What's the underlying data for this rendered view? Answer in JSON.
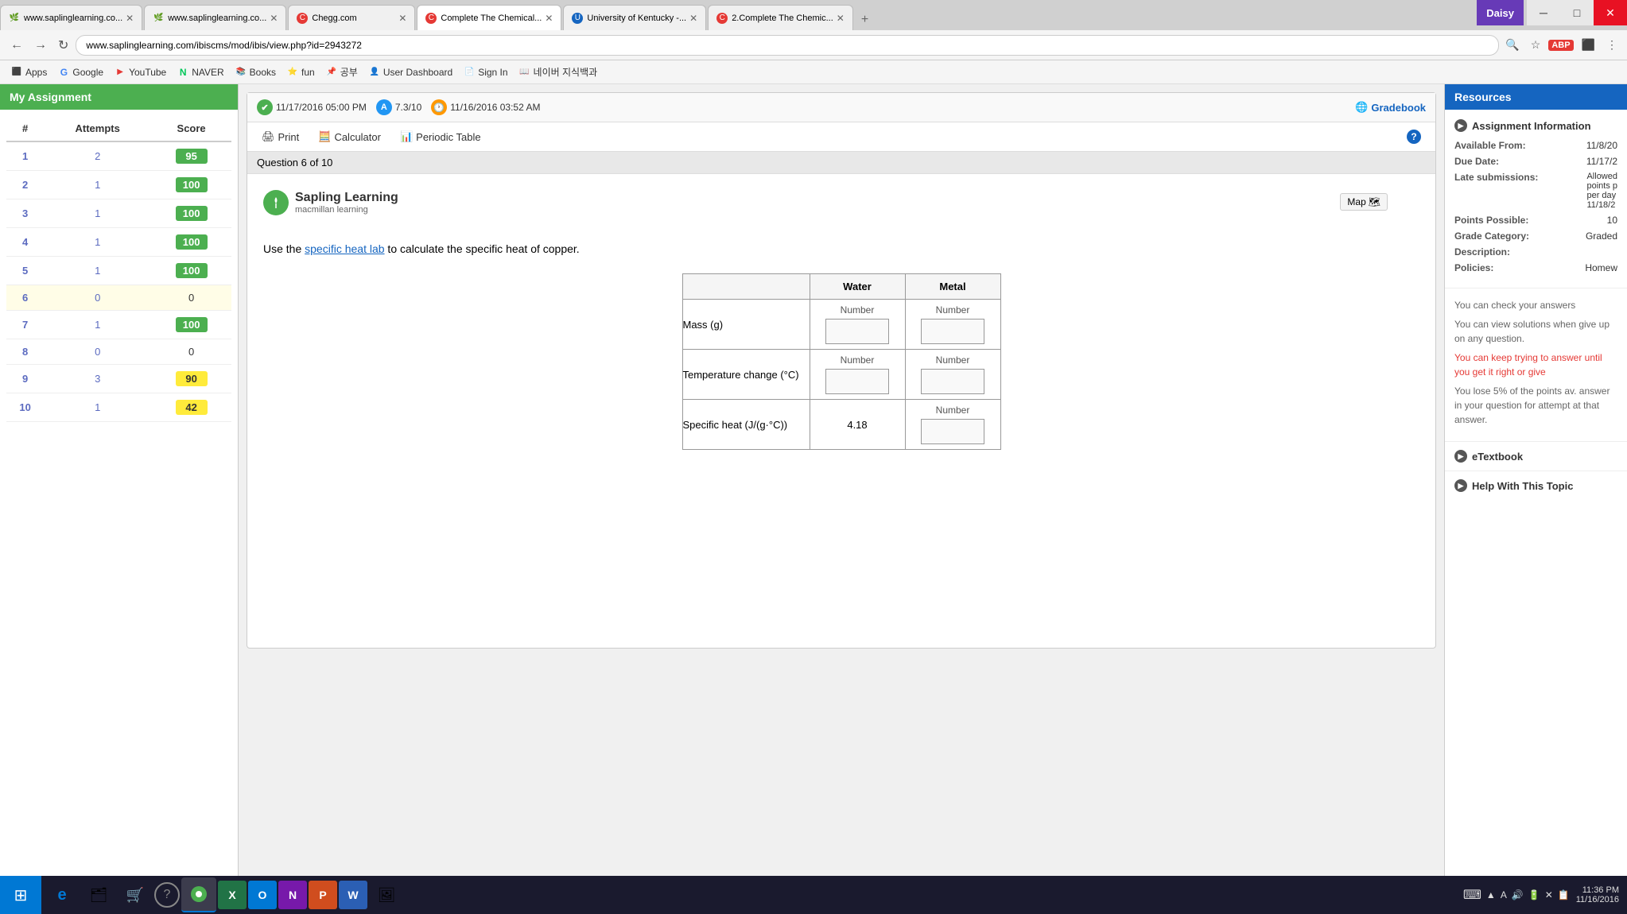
{
  "browser": {
    "tabs": [
      {
        "id": 1,
        "title": "www.saplinglearning.co...",
        "favicon": "🌿",
        "active": false,
        "favicon_color": "#4caf50"
      },
      {
        "id": 2,
        "title": "www.saplinglearning.co...",
        "favicon": "🌿",
        "active": false,
        "favicon_color": "#4caf50"
      },
      {
        "id": 3,
        "title": "Chegg.com",
        "favicon": "C",
        "active": false,
        "favicon_color": "#e53935"
      },
      {
        "id": 4,
        "title": "Complete The Chemical...",
        "favicon": "C",
        "active": true,
        "favicon_color": "#e53935"
      },
      {
        "id": 5,
        "title": "University of Kentucky -...",
        "favicon": "U",
        "active": false,
        "favicon_color": "#1565c0"
      },
      {
        "id": 6,
        "title": "2.Complete The Chemic...",
        "favicon": "C",
        "active": false,
        "favicon_color": "#e53935"
      }
    ],
    "url": "www.saplinglearning.com/ibiscms/mod/ibis/view.php?id=2943272",
    "daisy_label": "Daisy"
  },
  "bookmarks": [
    {
      "label": "Apps",
      "icon": "⬜"
    },
    {
      "label": "Google",
      "icon": "G"
    },
    {
      "label": "YouTube",
      "icon": "▶"
    },
    {
      "label": "NAVER",
      "icon": "N"
    },
    {
      "label": "Books",
      "icon": "📚"
    },
    {
      "label": "fun",
      "icon": "⭐"
    },
    {
      "label": "공부",
      "icon": "📌"
    },
    {
      "label": "User Dashboard",
      "icon": "👤"
    },
    {
      "label": "Sign In",
      "icon": "📄"
    },
    {
      "label": "네이버 지식백과",
      "icon": "📖"
    }
  ],
  "sidebar": {
    "header": "My Assignment",
    "columns": [
      "#",
      "Attempts",
      "Score"
    ],
    "rows": [
      {
        "num": 1,
        "attempts": 2,
        "score": 95,
        "score_type": "green"
      },
      {
        "num": 2,
        "attempts": 1,
        "score": 100,
        "score_type": "green"
      },
      {
        "num": 3,
        "attempts": 1,
        "score": 100,
        "score_type": "green"
      },
      {
        "num": 4,
        "attempts": 1,
        "score": 100,
        "score_type": "green"
      },
      {
        "num": 5,
        "attempts": 1,
        "score": 100,
        "score_type": "green"
      },
      {
        "num": 6,
        "attempts": 0,
        "score": 0,
        "score_type": "zero",
        "active": true
      },
      {
        "num": 7,
        "attempts": 1,
        "score": 100,
        "score_type": "green"
      },
      {
        "num": 8,
        "attempts": 0,
        "score": 0,
        "score_type": "zero"
      },
      {
        "num": 9,
        "attempts": 3,
        "score": 90,
        "score_type": "yellow"
      },
      {
        "num": 10,
        "attempts": 1,
        "score": 42,
        "score_type": "yellow"
      }
    ]
  },
  "question": {
    "header": {
      "date1": "11/17/2016 05:00 PM",
      "score": "7.3/10",
      "date2": "11/16/2016 03:52 AM",
      "gradebook_label": "Gradebook"
    },
    "toolbar": {
      "print_label": "Print",
      "calculator_label": "Calculator",
      "periodic_table_label": "Periodic Table"
    },
    "question_number": "Question 6 of 10",
    "sapling_title": "Sapling Learning",
    "sapling_subtitle": "macmillan learning",
    "map_label": "Map",
    "instruction": "Use the specific heat lab to calculate the specific heat of copper.",
    "instruction_link": "specific heat lab",
    "table": {
      "headers": [
        "",
        "Water",
        "Metal"
      ],
      "rows": [
        {
          "label": "Mass (g)",
          "water": {
            "type": "input",
            "placeholder": "Number"
          },
          "metal": {
            "type": "input",
            "placeholder": "Number"
          }
        },
        {
          "label": "Temperature change (°C)",
          "water": {
            "type": "input",
            "placeholder": "Number"
          },
          "metal": {
            "type": "input",
            "placeholder": "Number"
          }
        },
        {
          "label": "Specific heat (J/(g·°C))",
          "water": {
            "type": "static",
            "value": "4.18"
          },
          "metal": {
            "type": "input",
            "placeholder": "Number"
          }
        }
      ]
    }
  },
  "right_sidebar": {
    "header": "Resources",
    "assignment_info_title": "Assignment Information",
    "fields": [
      {
        "label": "Available From:",
        "value": "11/8/20"
      },
      {
        "label": "Due Date:",
        "value": "11/17/2"
      },
      {
        "label": "Late submissions:",
        "value": "Allowed\npoints p\nper day\n11/18/2"
      }
    ],
    "points_possible_label": "Points Possible:",
    "points_possible_value": "10",
    "grade_category_label": "Grade Category:",
    "grade_category_value": "Graded",
    "description_label": "Description:",
    "policies_label": "Policies:",
    "policies_value": "Homew",
    "policy_texts": [
      "You can check your answers",
      "You can view solutions when give up on any question.",
      "You can keep trying to answer until you get it right or give",
      "You lose 5% of the points av. answer in your question for attempt at that answer."
    ],
    "etextbook_label": "eTextbook",
    "help_label": "Help With This Topic"
  },
  "taskbar": {
    "time": "11:36 PM",
    "date": "11/16/2016",
    "items": [
      {
        "icon": "⊞",
        "label": "Start",
        "type": "start"
      },
      {
        "icon": "e",
        "label": "Internet Explorer",
        "color": "#0078d4"
      },
      {
        "icon": "🗂",
        "label": "File Explorer"
      },
      {
        "icon": "🛒",
        "label": "Store"
      },
      {
        "icon": "?",
        "label": "Help"
      },
      {
        "icon": "●",
        "label": "Chrome",
        "active": true,
        "color": "#4caf50"
      },
      {
        "icon": "X",
        "label": "Excel",
        "color": "#217346"
      },
      {
        "icon": "O",
        "label": "Outlook",
        "color": "#0078d4"
      },
      {
        "icon": "N",
        "label": "OneNote",
        "color": "#7719aa"
      },
      {
        "icon": "P",
        "label": "PowerPoint",
        "color": "#d04d1e"
      },
      {
        "icon": "W",
        "label": "Word",
        "color": "#2b5fb4"
      },
      {
        "icon": "🖼",
        "label": "Photos"
      }
    ]
  }
}
